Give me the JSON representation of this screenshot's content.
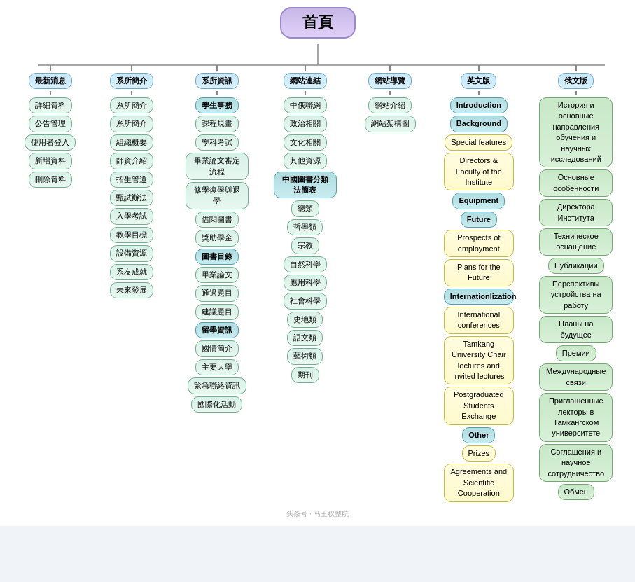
{
  "root": "首頁",
  "level1": [
    {
      "id": "news",
      "label": "最新消息"
    },
    {
      "id": "dept-intro",
      "label": "系所簡介"
    },
    {
      "id": "dept-info",
      "label": "系所資訊"
    },
    {
      "id": "website-links",
      "label": "網站連結"
    },
    {
      "id": "website-guide",
      "label": "網站導覽"
    },
    {
      "id": "english",
      "label": "英文版"
    },
    {
      "id": "russian",
      "label": "俄文版"
    }
  ],
  "news_items": [
    "詳細資料",
    "公告管理",
    "使用者登入",
    "新增資料",
    "刪除資料"
  ],
  "dept_intro_items": [
    "系所簡介",
    "系所簡介",
    "組織概要",
    "師資介紹",
    "招生管道",
    "甄試辦法",
    "入學考試",
    "教學目標",
    "設備資源",
    "系友成就",
    "未來發展"
  ],
  "dept_info_items": [
    {
      "label": "學生事務",
      "sub": []
    },
    {
      "label": "課程規畫",
      "sub": []
    },
    {
      "label": "學科考試",
      "sub": []
    },
    {
      "label": "畢業論文審定流程",
      "sub": []
    },
    {
      "label": "修學復學與退學",
      "sub": []
    },
    {
      "label": "借閱圖書",
      "sub": []
    },
    {
      "label": "獎助學金",
      "sub": []
    },
    {
      "label": "圖書目錄",
      "sub": []
    },
    {
      "label": "畢業論文",
      "sub": []
    },
    {
      "label": "通過題目",
      "sub": []
    },
    {
      "label": "建議題目",
      "sub": []
    },
    {
      "label": "留學資訊",
      "sub": []
    },
    {
      "label": "國情簡介",
      "sub": []
    },
    {
      "label": "主要大學",
      "sub": []
    },
    {
      "label": "緊急聯絡資訊",
      "sub": []
    },
    {
      "label": "國際化活動",
      "sub": []
    }
  ],
  "website_links_items": [
    {
      "label": "中俄聯網",
      "sub": []
    },
    {
      "label": "政治相關",
      "sub": []
    },
    {
      "label": "文化相關",
      "sub": []
    },
    {
      "label": "其他資源",
      "sub": []
    },
    {
      "label": "中國圖書分類法簡表",
      "sub": []
    },
    {
      "label": "總類",
      "sub": []
    },
    {
      "label": "哲學類",
      "sub": []
    },
    {
      "label": "宗教",
      "sub": []
    },
    {
      "label": "自然科學",
      "sub": []
    },
    {
      "label": "應用科學",
      "sub": []
    },
    {
      "label": "社會科學",
      "sub": []
    },
    {
      "label": "史地類",
      "sub": []
    },
    {
      "label": "語文類",
      "sub": []
    },
    {
      "label": "藝術類",
      "sub": []
    },
    {
      "label": "期刊",
      "sub": []
    }
  ],
  "website_guide_items": [
    "網站介紹",
    "網站架構圖"
  ],
  "english_items": [
    {
      "label": "Introduction",
      "type": "teal"
    },
    {
      "label": "Background",
      "type": "teal"
    },
    {
      "label": "Special features",
      "type": "yellow"
    },
    {
      "label": "Directors & Faculty of the Institute",
      "type": "yellow"
    },
    {
      "label": "Equipment",
      "type": "teal"
    },
    {
      "label": "Future",
      "type": "teal"
    },
    {
      "label": "Prospects of employment",
      "type": "yellow"
    },
    {
      "label": "Plans for the Future",
      "type": "yellow"
    },
    {
      "label": "Internationlization",
      "type": "teal"
    },
    {
      "label": "International conferences",
      "type": "yellow"
    },
    {
      "label": "Tamkang University Chair lectures and invited lectures",
      "type": "yellow"
    },
    {
      "label": "Postgraduated Students Exchange",
      "type": "yellow"
    },
    {
      "label": "Other",
      "type": "teal"
    },
    {
      "label": "Prizes",
      "type": "yellow"
    },
    {
      "label": "Agreements and Scientific Cooperation",
      "type": "yellow"
    }
  ],
  "russian_items": [
    "История и основные направления обучения и научных исследований",
    "Основные особенности",
    "Директора Института",
    "Техническое оснащение",
    "Публикации",
    "Перспективы устройства на работу",
    "Планы на будущее",
    "Премии",
    "Международные связи",
    "Приглашенные лекторы в Тамкангском университете",
    "Соглашения и научное сотрудничество",
    "Обмен"
  ]
}
